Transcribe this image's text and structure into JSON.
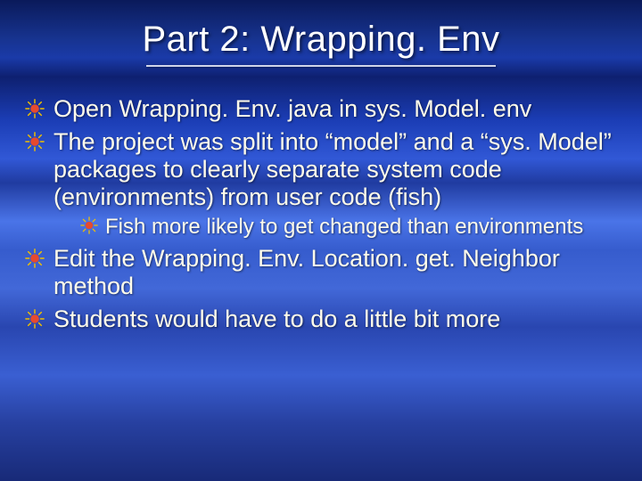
{
  "title": "Part 2: Wrapping. Env",
  "bullets": {
    "b1": "Open Wrapping. Env. java in sys. Model. env",
    "b2": "The project was split into “model” and a “sys. Model” packages to clearly separate system code (environments) from user code (fish)",
    "b2_1": "Fish more likely to get changed than environments",
    "b3": "Edit the Wrapping. Env. Location. get. Neighbor method",
    "b4": "Students would have to do a little bit more"
  }
}
